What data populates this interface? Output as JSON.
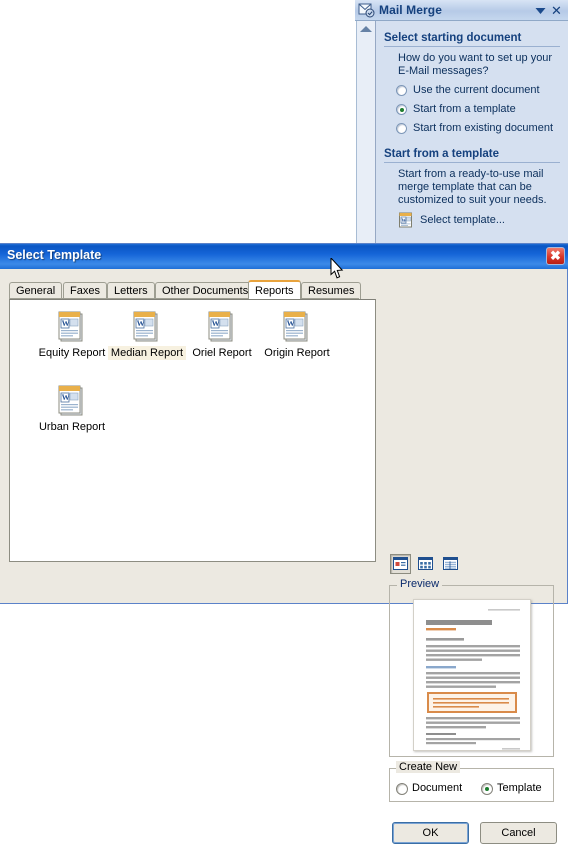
{
  "document_area": {
    "scrollbar": {
      "name": "document-vertical-scrollbar",
      "up_arrow": "scroll-up-arrow"
    }
  },
  "task_pane": {
    "title": "Mail Merge",
    "icon": "mail-merge-icon",
    "dropdown_icon": "chevron-down-icon",
    "close_icon": "close-icon",
    "sections": [
      {
        "heading": "Select starting document",
        "question": "How do you want to set up your E-Mail messages?",
        "options": [
          {
            "label": "Use the current document",
            "checked": false
          },
          {
            "label": "Start from a template",
            "checked": true
          },
          {
            "label": "Start from existing document",
            "checked": false
          }
        ]
      },
      {
        "heading": "Start from a template",
        "description": "Start from a ready-to-use mail merge template that can be customized to suit your needs.",
        "link": "Select template...",
        "link_icon": "word-template-icon"
      }
    ]
  },
  "dialog": {
    "title": "Select Template",
    "close_icon": "close-icon",
    "cursor_icon": "mouse-pointer-icon",
    "tabs": [
      {
        "label": "General",
        "active": false
      },
      {
        "label": "Faxes",
        "active": false
      },
      {
        "label": "Letters",
        "active": false
      },
      {
        "label": "Other Documents",
        "active": false
      },
      {
        "label": "Reports",
        "active": true
      },
      {
        "label": "Resumes",
        "active": false
      }
    ],
    "templates": [
      {
        "label": "Equity Report",
        "icon": "word-template-icon",
        "hover": false
      },
      {
        "label": "Median Report",
        "icon": "word-template-icon",
        "hover": true
      },
      {
        "label": "Oriel Report",
        "icon": "word-template-icon",
        "hover": false
      },
      {
        "label": "Origin Report",
        "icon": "word-template-icon",
        "hover": false
      },
      {
        "label": "Urban Report",
        "icon": "word-template-icon",
        "hover": false
      }
    ],
    "view_buttons": [
      {
        "name": "large-icons-view-button",
        "icon": "large-icons-icon",
        "pressed": true
      },
      {
        "name": "list-view-button",
        "icon": "list-icon",
        "pressed": false
      },
      {
        "name": "details-view-button",
        "icon": "details-icon",
        "pressed": false
      }
    ],
    "preview": {
      "legend": "Preview",
      "document_title_placeholder": "XXXXXXXXXXXXXXXXX"
    },
    "create_new": {
      "legend": "Create New",
      "options": [
        {
          "label": "Document",
          "checked": false
        },
        {
          "label": "Template",
          "checked": true
        }
      ]
    },
    "buttons": {
      "ok": "OK",
      "cancel": "Cancel"
    }
  },
  "colors": {
    "titlebar_blue": "#1565d8",
    "dialog_face": "#ece9e1",
    "taskpane_bg": "#d5e0f0",
    "heading_blue": "#15417e",
    "active_tab_accent": "#e8a33d",
    "radio_dot_green": "#1d7d2f",
    "close_red": "#d8372a"
  }
}
